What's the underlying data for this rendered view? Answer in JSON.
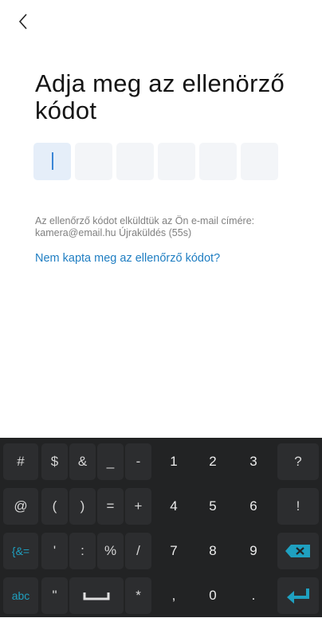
{
  "nav": {
    "back_icon": "chevron-left-icon"
  },
  "title": "Adja meg az ellenörző kódot",
  "code": {
    "boxes": [
      "",
      "",
      "",
      "",
      "",
      ""
    ],
    "active_index": 0
  },
  "info": {
    "text": "Az ellenőrző kódot elküldtük az Ön e-mail címére:",
    "email": "kamera@email.hu",
    "resend": "Újraküldés (55s)"
  },
  "help_link": "Nem kapta meg az ellenőrző kódot?",
  "keyboard": {
    "row1": [
      "#",
      "$",
      "&",
      "_",
      "-",
      "1",
      "2",
      "3",
      "?"
    ],
    "row2": [
      "@",
      "(",
      ")",
      "=",
      "+",
      "4",
      "5",
      "6",
      "!"
    ],
    "row3": [
      "{&=",
      "'",
      ":",
      "%",
      "/",
      "7",
      "8",
      "9"
    ],
    "row4": [
      "abc",
      "\"",
      "*",
      ",",
      "0",
      "."
    ],
    "backspace_icon": "backspace-icon",
    "space_icon": "space-bar-icon",
    "enter_icon": "enter-icon",
    "accent_color": "#1fa0c0",
    "background": "#222324"
  }
}
